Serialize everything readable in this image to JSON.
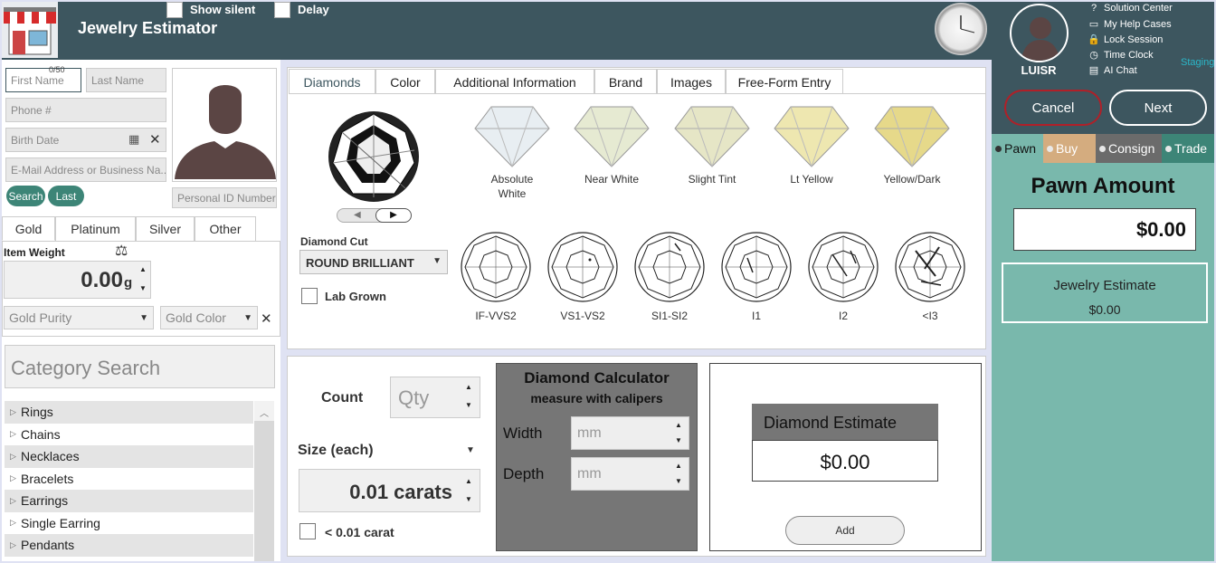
{
  "header": {
    "app_title": "Jewelry Estimator",
    "show_silent_label": "Show silent",
    "delay_label": "Delay"
  },
  "user": {
    "name": "LUISR",
    "links": [
      "Solution Center",
      "My Help Cases",
      "Lock Session",
      "Time Clock",
      "AI Chat"
    ],
    "environment": "Staging"
  },
  "actions": {
    "cancel_label": "Cancel",
    "next_label": "Next"
  },
  "transaction_tabs": [
    {
      "label": "Pawn",
      "color": "#3d565f"
    },
    {
      "label": "Buy",
      "color": "#d4ac7f"
    },
    {
      "label": "Consign",
      "color": "#6b6b6b"
    },
    {
      "label": "Trade",
      "color": "#3d8577"
    }
  ],
  "pawn": {
    "title": "Pawn Amount",
    "amount": "$0.00",
    "jewelry_estimate_label": "Jewelry Estimate",
    "jewelry_estimate_value": "$0.00"
  },
  "customer": {
    "first_name_placeholder": "First Name",
    "first_name_counter": "0/50",
    "last_name_placeholder": "Last Name",
    "phone_placeholder": "Phone #",
    "birth_date_placeholder": "Birth Date",
    "email_placeholder": "E-Mail Address or Business Na...",
    "search_label": "Search",
    "last_label": "Last",
    "personal_id_placeholder": "Personal ID Number"
  },
  "metal": {
    "tabs": [
      "Gold",
      "Platinum",
      "Silver",
      "Other"
    ],
    "item_weight_label": "Item Weight",
    "weight_value": "0.00",
    "weight_unit": "g",
    "gold_purity_placeholder": "Gold Purity",
    "gold_color_placeholder": "Gold Color"
  },
  "category": {
    "search_placeholder": "Category Search",
    "items": [
      "Rings",
      "Chains",
      "Necklaces",
      "Bracelets",
      "Earrings",
      "Single Earring",
      "Pendants"
    ]
  },
  "diamond_tabs": [
    "Diamonds",
    "Color",
    "Additional Information",
    "Brand",
    "Images",
    "Free-Form Entry"
  ],
  "diamond": {
    "colors": [
      {
        "label": "Absolute White",
        "tint": "#e8eef2"
      },
      {
        "label": "Near White",
        "tint": "#e6ead2"
      },
      {
        "label": "Slight Tint",
        "tint": "#e6e6c6"
      },
      {
        "label": "Lt Yellow",
        "tint": "#eee7b0"
      },
      {
        "label": "Yellow/Dark",
        "tint": "#e6d98a"
      }
    ],
    "cut_label": "Diamond Cut",
    "cut_value": "ROUND BRILLIANT",
    "lab_grown_label": "Lab Grown",
    "clarity": [
      "IF-VVS2",
      "VS1-VS2",
      "SI1-SI2",
      "I1",
      "I2",
      "<I3"
    ]
  },
  "calculator": {
    "count_label": "Count",
    "qty_placeholder": "Qty",
    "size_label": "Size (each)",
    "size_value": "0.01 carats",
    "small_carat_label": "< 0.01 carat",
    "title": "Diamond Calculator",
    "subtitle": "measure with calipers",
    "width_label": "Width",
    "depth_label": "Depth",
    "mm_placeholder": "mm",
    "estimate_label": "Diamond Estimate",
    "estimate_value": "$0.00",
    "add_label": "Add"
  }
}
